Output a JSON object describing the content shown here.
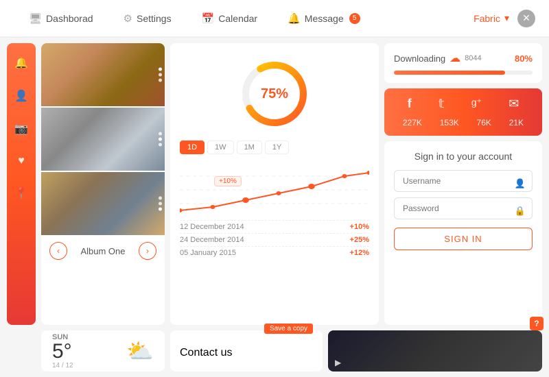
{
  "nav": {
    "items": [
      {
        "label": "Dashborad",
        "icon": "🖥",
        "active": false
      },
      {
        "label": "Settings",
        "icon": "⚙",
        "active": false
      },
      {
        "label": "Calendar",
        "icon": "📅",
        "active": false
      },
      {
        "label": "Message",
        "icon": "🔔",
        "badge": "5",
        "active": false
      }
    ],
    "fabric_label": "Fabric",
    "fabric_arrow": "▾"
  },
  "sidebar": {
    "icons": [
      "🔔",
      "👤",
      "📷",
      "♥",
      "📍"
    ]
  },
  "album": {
    "title": "Album One",
    "prev_label": "‹",
    "next_label": "›"
  },
  "weather": {
    "day": "SUN",
    "temp": "5°",
    "date": "14 / 12",
    "icon": "⛅"
  },
  "chart": {
    "donut_pct": "75%",
    "tabs": [
      "1D",
      "1W",
      "1M",
      "1Y"
    ],
    "active_tab": "1D",
    "legend": "+10%",
    "rows": [
      {
        "date": "12 December 2014",
        "val": "+10%"
      },
      {
        "date": "24 December 2014",
        "val": "+25%"
      },
      {
        "date": "05 January 2015",
        "val": "+12%"
      }
    ]
  },
  "download": {
    "title": "Downloading",
    "number": "8044",
    "pct": "80%",
    "fill_width": "80%"
  },
  "social": {
    "icons": [
      "f",
      "𝕥",
      "g⁺",
      "✉"
    ],
    "stats": [
      "227K",
      "153K",
      "76K",
      "21K"
    ]
  },
  "signin": {
    "title": "Sign in to your account",
    "username_placeholder": "Username",
    "password_placeholder": "Password",
    "button_label": "SIGN IN",
    "help": "?"
  },
  "contact": {
    "title": "Contact us",
    "save_label": "Save a copy"
  }
}
